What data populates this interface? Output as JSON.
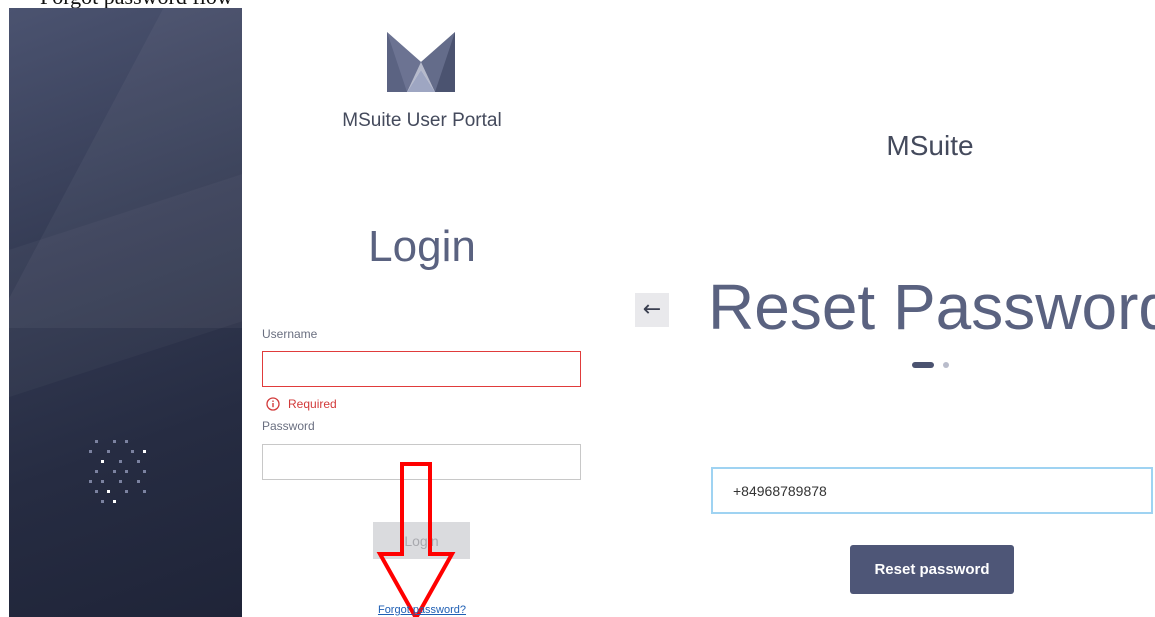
{
  "caption": {
    "text": "Forgot password flow"
  },
  "login": {
    "portal_title": "MSuite User Portal",
    "heading": "Login",
    "username_label": "Username",
    "username_value": "",
    "required_message": "Required",
    "password_label": "Password",
    "password_value": "",
    "login_button": "Login",
    "forgot_link": "Forgot password?"
  },
  "reset": {
    "brand_title": "MSuite",
    "back_icon": "←",
    "heading": "Reset Password",
    "phone_value": "+84968789878",
    "reset_button": "Reset password",
    "step_total": 2,
    "step_current": 1
  },
  "colors": {
    "accent": "#4e5677",
    "error": "#e03b3b",
    "link": "#1f5fb4",
    "annotation_arrow": "#ff0000"
  }
}
